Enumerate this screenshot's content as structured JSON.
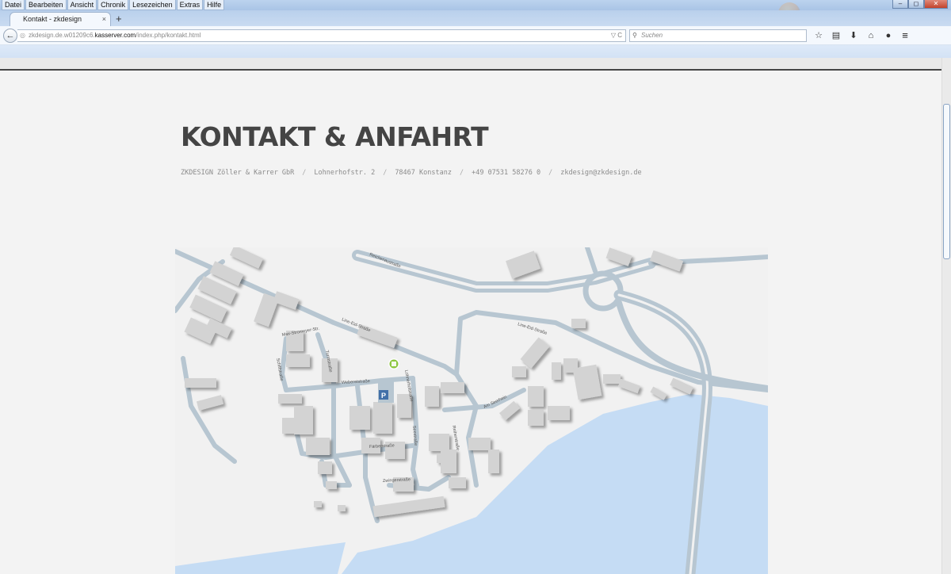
{
  "browser": {
    "menu": [
      "Datei",
      "Bearbeiten",
      "Ansicht",
      "Chronik",
      "Lesezeichen",
      "Extras",
      "Hilfe"
    ],
    "window_buttons": [
      "–",
      "◻",
      "✕"
    ],
    "tab_title": "Kontakt - zkdesign",
    "tab_close": "×",
    "new_tab": "+",
    "url_prefix": "zkdesign.de.w01209c6.",
    "url_domain": "kasserver.com",
    "url_path": "/index.php/kontakt.html",
    "url_icons": "▽ C",
    "search_placeholder": "Suchen",
    "toolbar_icons": [
      "star-icon",
      "clipboard-icon",
      "download-icon",
      "home-icon",
      "chat-icon"
    ],
    "toolbar_glyphs": [
      "☆",
      "▤",
      "⬇",
      "⌂",
      "●"
    ],
    "menu_glyph": "≡",
    "back_glyph": "←"
  },
  "page": {
    "title": "KONTAKT & ANFAHRT",
    "contact": {
      "company": "ZKDESIGN Zöller & Karrer GbR",
      "street": "Lohnerhofstr. 2",
      "city": "78467 Konstanz",
      "phone": "+49 07531 58276 0",
      "email": "zkdesign@zkdesign.de",
      "separator": "/"
    },
    "map": {
      "street_labels": {
        "reichenau": "Reichenaustraße",
        "line_eid_1": "Line-Eid-Straße",
        "line_eid_2": "Line-Eid-Straße",
        "max_stromeyer": "Max-Stromeyer-Str.",
        "turmstr": "Turmstraße",
        "schiffstr": "Schiffstraße",
        "lohnerhof": "Lohnerhofstraße",
        "webereistr": "Webereistraße",
        "faerberstr": "Färberstraße",
        "zwinger": "Zwingerstraße",
        "am_seerhein": "Am Seerhein",
        "reiherstr": "Reiherstraße",
        "seestr": "Seestraße"
      },
      "parking_label": "P",
      "colors": {
        "water": "#c5dcf4",
        "road": "#b7c6d1",
        "building": "#d2d2d2",
        "land": "#f1f1f1",
        "marker": "#8cc63f"
      }
    }
  }
}
